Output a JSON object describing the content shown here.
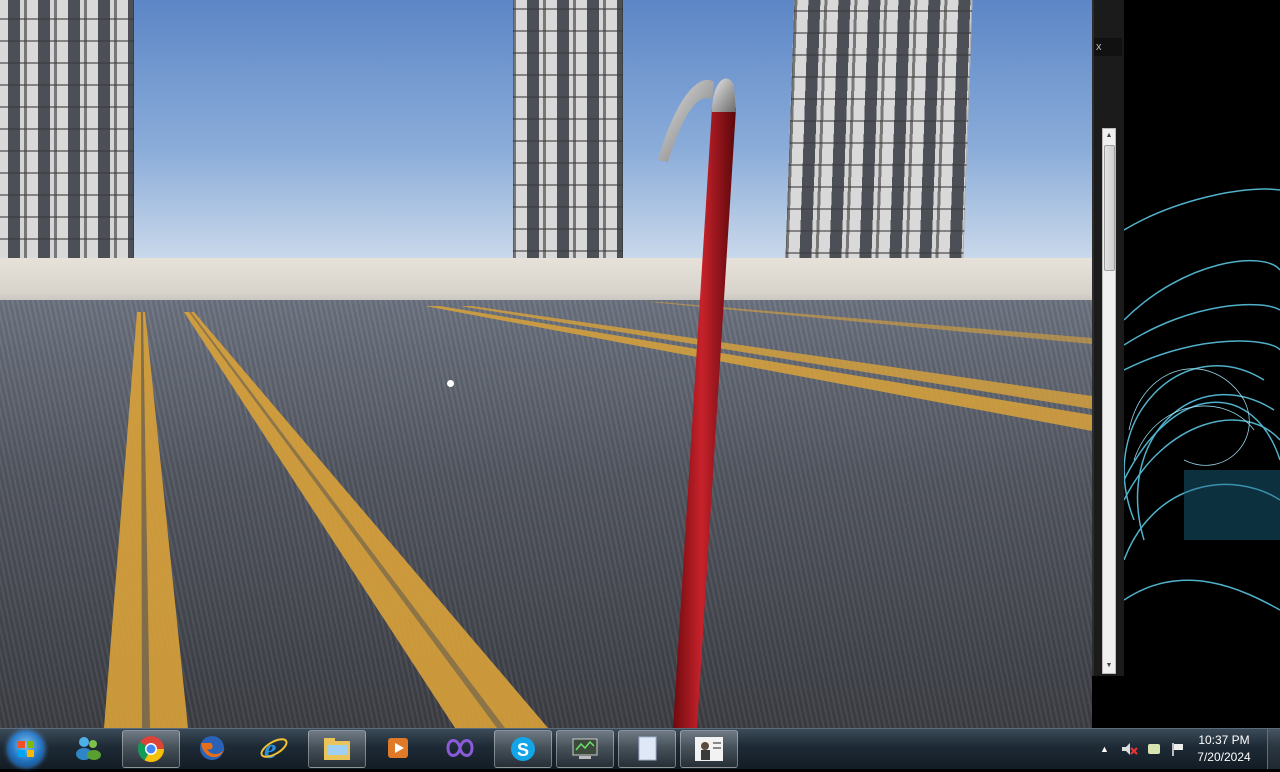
{
  "game": {
    "scene": "3d-city-street",
    "held_item": "crowbar",
    "crosshair": "dot"
  },
  "side_window": {
    "close_label": "x"
  },
  "taskbar": {
    "start_label": "Start",
    "pinned": [
      {
        "name": "windows-live-messenger-icon",
        "open": false
      },
      {
        "name": "chrome-icon",
        "open": true
      },
      {
        "name": "firefox-icon",
        "open": false
      },
      {
        "name": "internet-explorer-icon",
        "open": false
      },
      {
        "name": "file-explorer-icon",
        "open": true
      },
      {
        "name": "media-player-icon",
        "open": false
      },
      {
        "name": "visual-studio-icon",
        "open": false
      },
      {
        "name": "skype-icon",
        "open": true
      },
      {
        "name": "remote-desktop-icon",
        "open": true
      },
      {
        "name": "document-icon",
        "open": true
      },
      {
        "name": "image-viewer-icon",
        "open": true
      }
    ],
    "clock": {
      "time": "10:37 PM",
      "date": "7/20/2024"
    }
  },
  "colors": {
    "crowbar": "#b3141c",
    "road_line": "#d9a23a",
    "sky": "#7ea2d4",
    "taskbar": "#1d2a35"
  }
}
